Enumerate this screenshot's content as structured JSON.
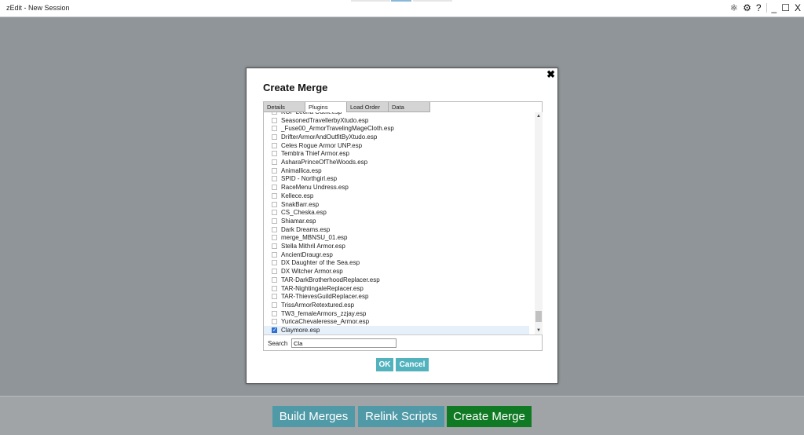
{
  "window": {
    "title": "zEdit - New Session",
    "icons": [
      "modules-icon",
      "gear-icon",
      "help-icon",
      "minimize-icon",
      "maximize-icon",
      "close-icon"
    ],
    "help": "?",
    "minimize": "_",
    "maximize": "☐",
    "close": "X"
  },
  "bottom": {
    "build": "Build Merges",
    "relink": "Relink Scripts",
    "create": "Create Merge"
  },
  "modal": {
    "title": "Create Merge",
    "close": "✖",
    "tabs": [
      "Details",
      "Plugins",
      "Load Order",
      "Data"
    ],
    "active_tab": "Plugins",
    "plugins": [
      {
        "name": "KOF Leona Outfit.esp",
        "checked": false
      },
      {
        "name": "SeasonedTravellerbyXtudo.esp",
        "checked": false
      },
      {
        "name": "_Fuse00_ArmorTravelingMageCloth.esp",
        "checked": false
      },
      {
        "name": "DrifterArmorAndOutfitByXtudo.esp",
        "checked": false
      },
      {
        "name": "Celes Rogue Armor UNP.esp",
        "checked": false
      },
      {
        "name": "Tembtra Thief Armor.esp",
        "checked": false
      },
      {
        "name": "AsharaPrinceOfTheWoods.esp",
        "checked": false
      },
      {
        "name": "Animallica.esp",
        "checked": false
      },
      {
        "name": "SPID - Northgirl.esp",
        "checked": false
      },
      {
        "name": "RaceMenu Undress.esp",
        "checked": false
      },
      {
        "name": "Kellece.esp",
        "checked": false
      },
      {
        "name": "SnakBarr.esp",
        "checked": false
      },
      {
        "name": "CS_Cheska.esp",
        "checked": false
      },
      {
        "name": "Shiamar.esp",
        "checked": false
      },
      {
        "name": "Dark Dreams.esp",
        "checked": false
      },
      {
        "name": "merge_MBNSU_01.esp",
        "checked": false
      },
      {
        "name": "Stella Mithril Armor.esp",
        "checked": false
      },
      {
        "name": "AncientDraugr.esp",
        "checked": false
      },
      {
        "name": "DX Daughter of the Sea.esp",
        "checked": false
      },
      {
        "name": "DX Witcher Armor.esp",
        "checked": false
      },
      {
        "name": "TAR-DarkBrotherhoodReplacer.esp",
        "checked": false
      },
      {
        "name": "TAR-NightingaleReplacer.esp",
        "checked": false
      },
      {
        "name": "TAR-ThievesGuildReplacer.esp",
        "checked": false
      },
      {
        "name": "TrissArmorRetextured.esp",
        "checked": false
      },
      {
        "name": "TW3_femaleArmors_zzjay.esp",
        "checked": false
      },
      {
        "name": "YuricaChevaleresse_Armor.esp",
        "checked": false
      },
      {
        "name": "Claymore.esp",
        "checked": true
      }
    ],
    "search_label": "Search",
    "search_value": "Cla",
    "ok": "OK",
    "cancel": "Cancel"
  }
}
